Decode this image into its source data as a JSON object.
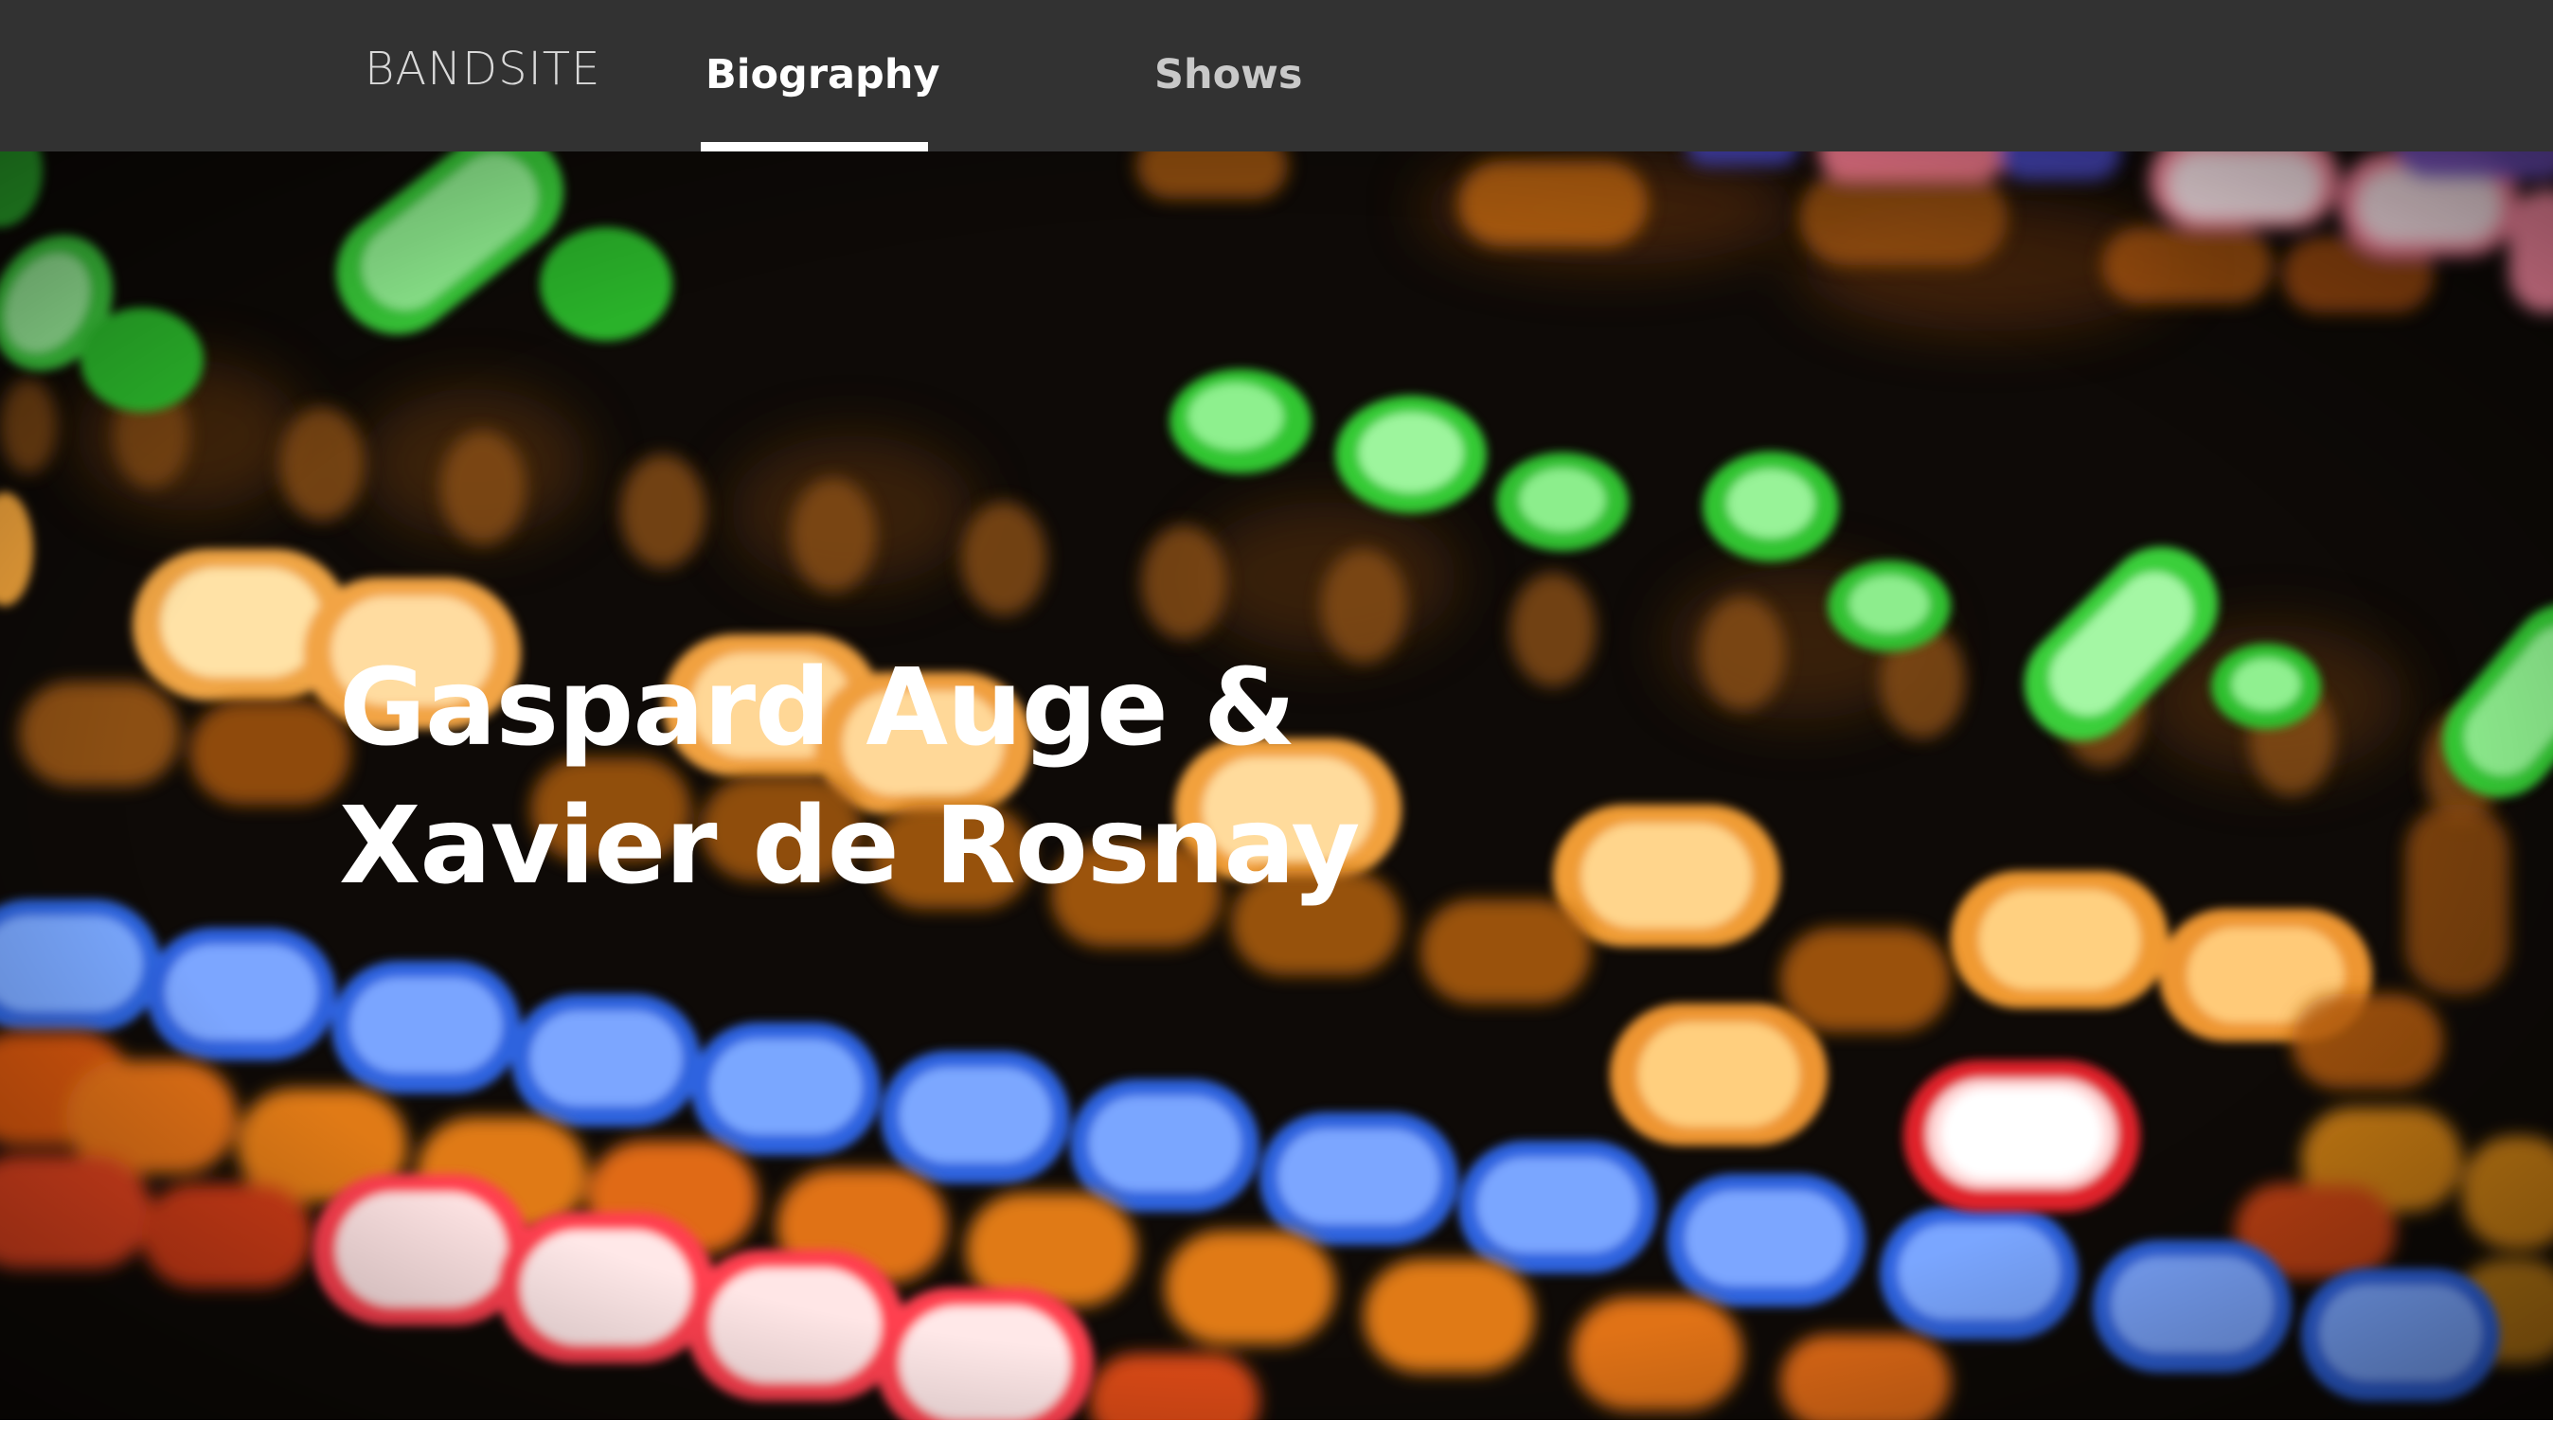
{
  "nav": {
    "logo": "BANDSITE",
    "links": [
      {
        "label": "Biography",
        "active": true
      },
      {
        "label": "Shows",
        "active": false
      }
    ],
    "bg_color": "#323232",
    "active_color": "#ffffff"
  },
  "hero": {
    "title_line1": "Gaspard Auge &",
    "title_line2": "Xavier de Rosnay",
    "background": "blurred colorful mixing console lights"
  }
}
